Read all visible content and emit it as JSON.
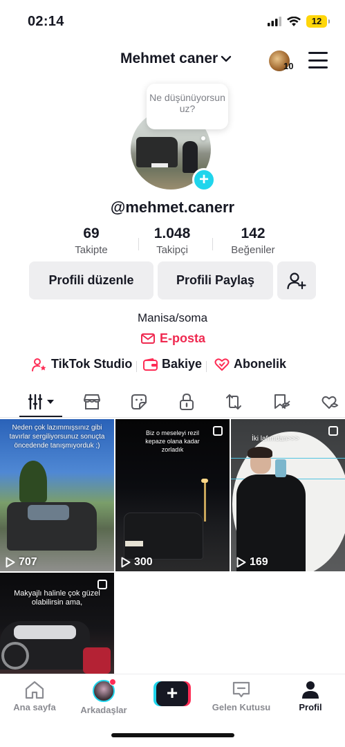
{
  "status_bar": {
    "time": "02:14",
    "battery": "12"
  },
  "header": {
    "account_name": "Mehmet caner",
    "avatar_badge": "10"
  },
  "profile": {
    "bubble_text": "Ne düşünüyorsun uz?",
    "username": "@mehmet.canerr",
    "stats": [
      {
        "value": "69",
        "label": "Takipte"
      },
      {
        "value": "1.048",
        "label": "Takipçi"
      },
      {
        "value": "142",
        "label": "Beğeniler"
      }
    ],
    "buttons": {
      "edit": "Profili düzenle",
      "share": "Profili Paylaş"
    },
    "bio": "Manisa/soma",
    "email_label": "E-posta",
    "tools": [
      {
        "label": "TikTok Studio",
        "icon": "person-star-icon"
      },
      {
        "label": "Bakiye",
        "icon": "wallet-icon"
      },
      {
        "label": "Abonelik",
        "icon": "subscription-heart-icon"
      }
    ]
  },
  "tabs": [
    "videos-grid",
    "shop",
    "sticker",
    "private-lock",
    "reposts",
    "favorites",
    "liked"
  ],
  "videos": [
    {
      "caption": "Neden çok lazımmışsınız gibi tavırlar sergiliyorsunuz sonuçta öncedende tanışmıyorduk ;)",
      "views": "707",
      "multi": false
    },
    {
      "caption": "Biz o meseleyi rezil kepaze olana kadar zorladık",
      "views": "300",
      "multi": true
    },
    {
      "caption": "İki lafımdan>>>",
      "views": "169",
      "multi": true
    },
    {
      "caption": "Makyajlı halinle çok güzel olabilirsin ama,",
      "views": "",
      "multi": true
    }
  ],
  "bottom_nav": {
    "home": "Ana sayfa",
    "friends": "Arkadaşlar",
    "inbox": "Gelen Kutusu",
    "profile": "Profil"
  },
  "colors": {
    "accent": "#fe2c55",
    "cyan": "#20d5ec",
    "link": "#ef2950"
  }
}
